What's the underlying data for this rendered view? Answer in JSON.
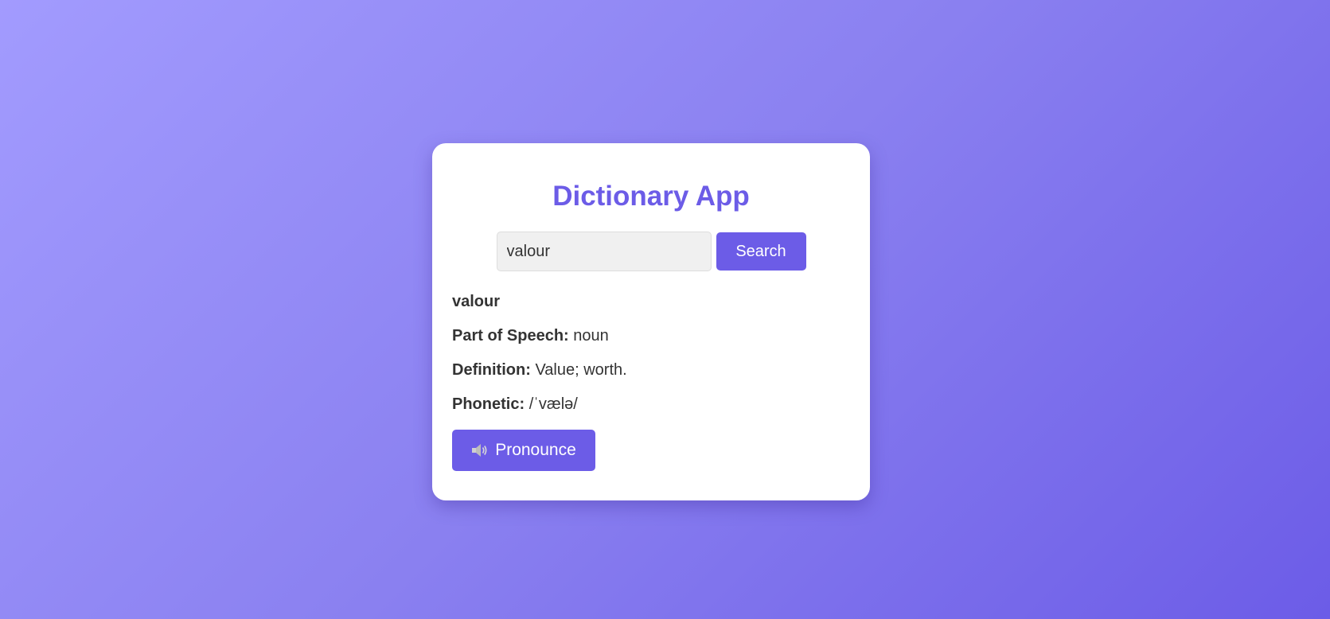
{
  "app": {
    "title": "Dictionary App"
  },
  "search": {
    "value": "valour",
    "button_label": "Search"
  },
  "result": {
    "word": "valour",
    "part_of_speech_label": "Part of Speech:",
    "part_of_speech": "noun",
    "definition_label": "Definition:",
    "definition": "Value; worth.",
    "phonetic_label": "Phonetic:",
    "phonetic": "/ˈvælə/"
  },
  "pronounce": {
    "label": "Pronounce",
    "icon": "speaker-icon"
  },
  "colors": {
    "accent": "#6c5ce7",
    "background_start": "#a29bfe",
    "background_end": "#6c5ce7"
  }
}
